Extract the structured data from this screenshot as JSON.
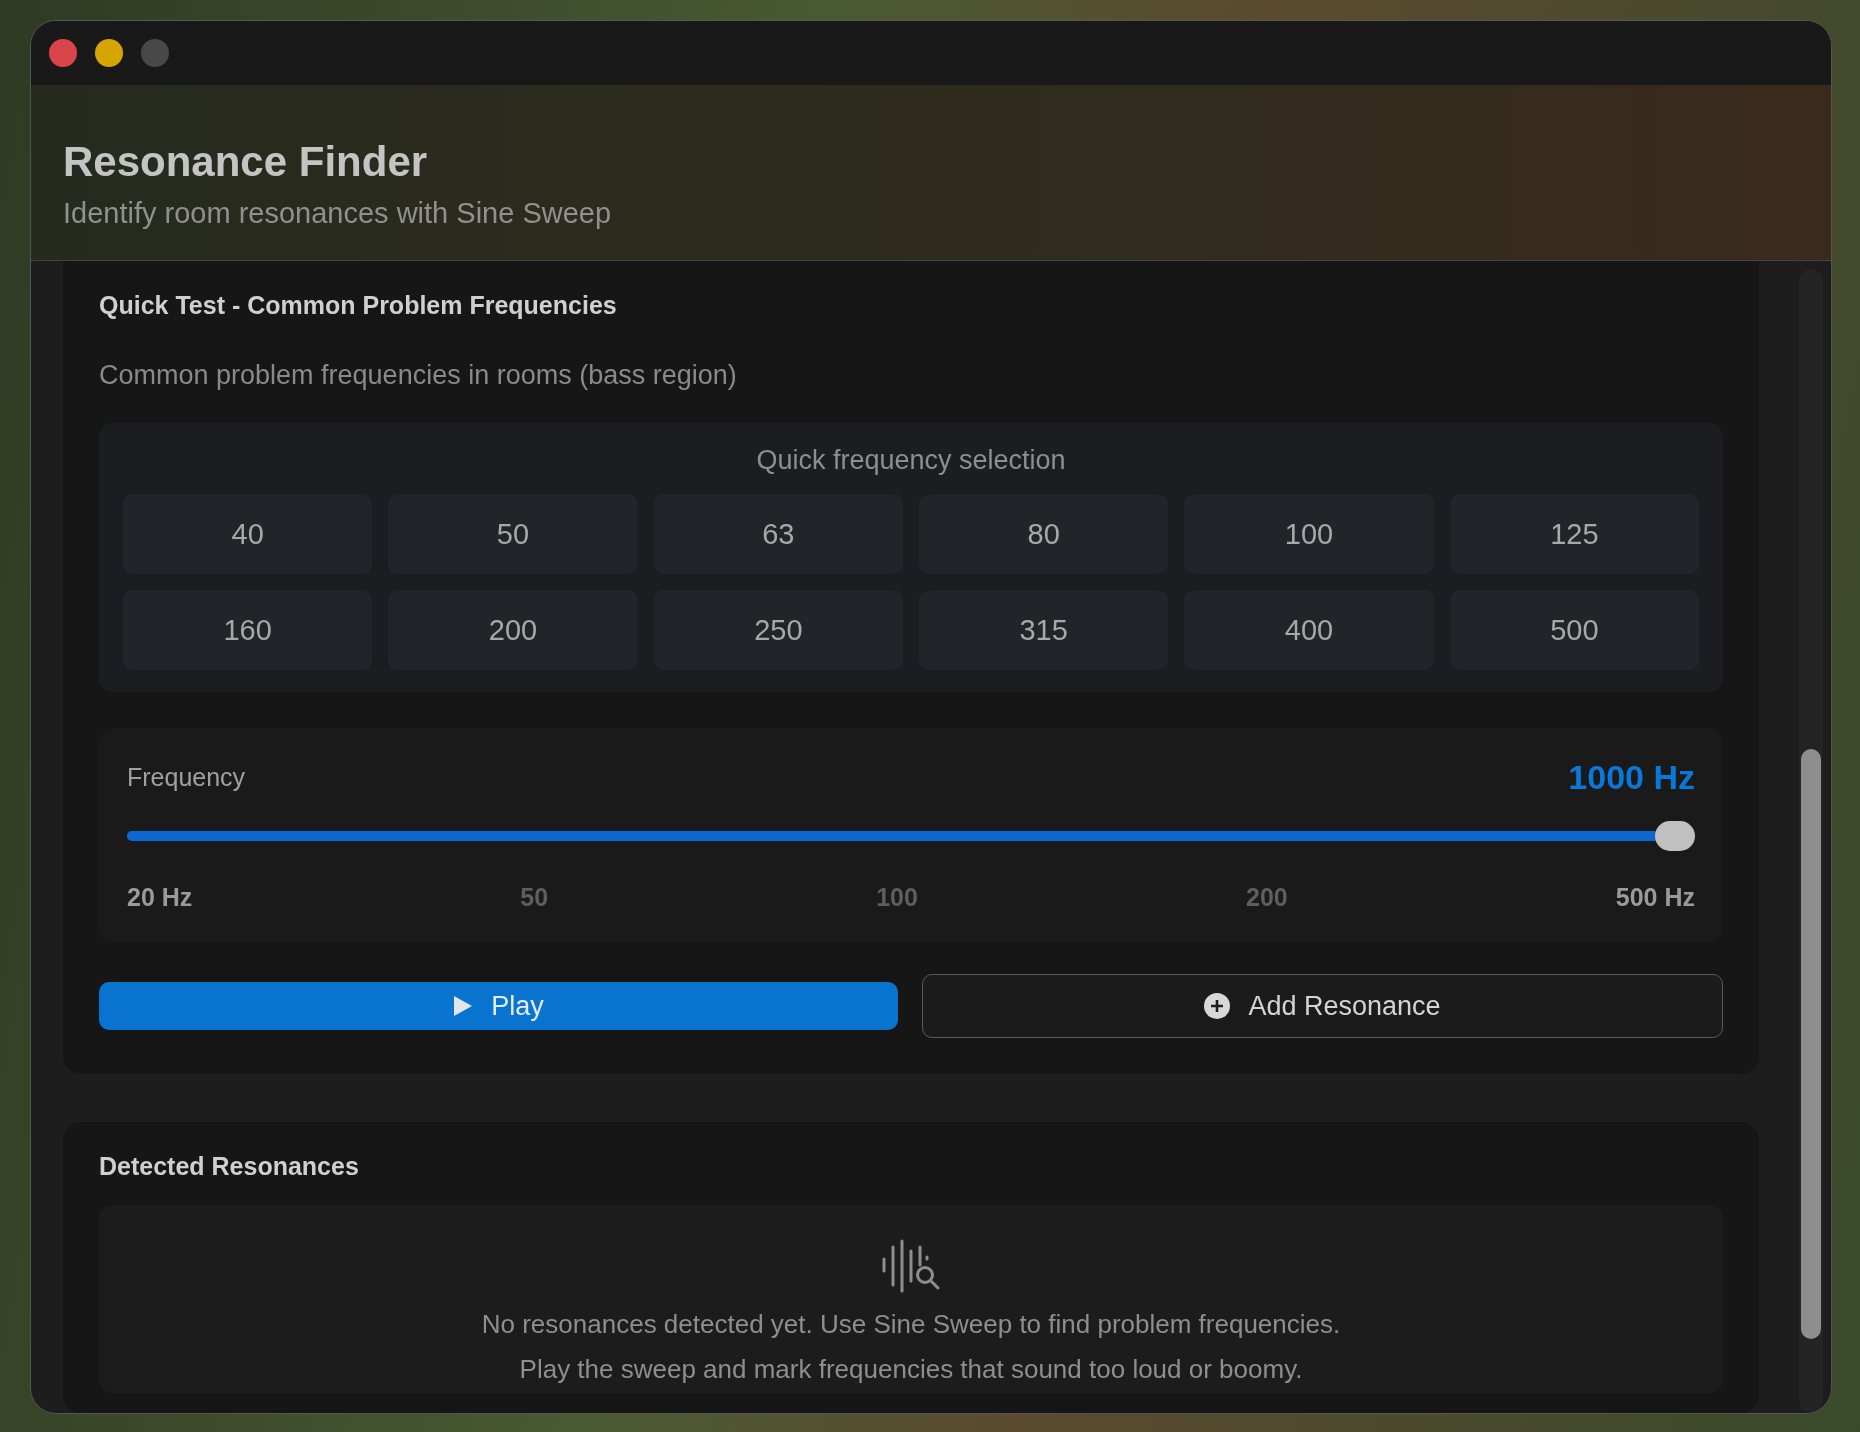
{
  "window": {
    "title": "Resonance Finder",
    "subtitle": "Identify room resonances with Sine Sweep"
  },
  "quick_test": {
    "title": "Quick Test - Common Problem Frequencies",
    "description": "Common problem frequencies in rooms (bass region)",
    "quick_selection": {
      "label": "Quick frequency selection",
      "frequencies": [
        "40",
        "50",
        "63",
        "80",
        "100",
        "125",
        "160",
        "200",
        "250",
        "315",
        "400",
        "500"
      ]
    },
    "frequency": {
      "label": "Frequency",
      "reading": "1000 Hz",
      "level": 1,
      "ticks": [
        "20 Hz",
        "50",
        "100",
        "200",
        "500 Hz"
      ]
    },
    "buttons": [
      {
        "kind": "primary",
        "label": "Play"
      },
      {
        "kind": "secondary",
        "label": "Add Resonance"
      }
    ]
  },
  "detected": {
    "title": "Detected Resonances",
    "empty_lines": [
      "No resonances detected yet. Use Sine Sweep to find problem frequencies.",
      "Play the sweep and mark frequencies that sound too loud or boomy."
    ]
  }
}
